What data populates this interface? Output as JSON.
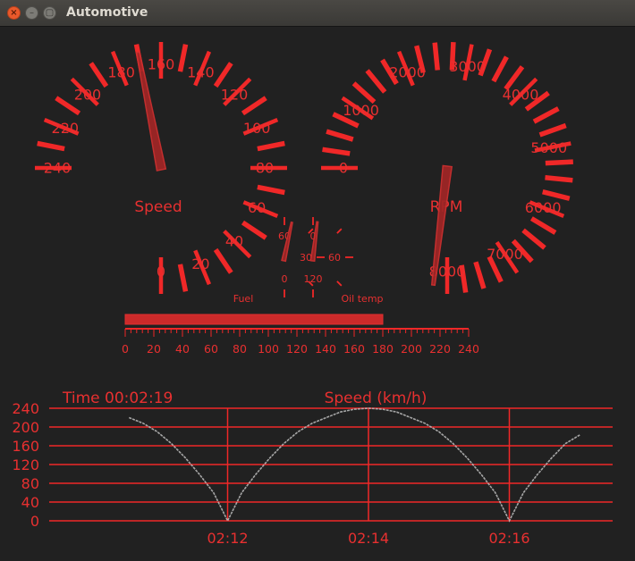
{
  "window": {
    "title": "Automotive",
    "buttons": {
      "close": "×",
      "minimize": "–",
      "maximize": "▢"
    }
  },
  "colors": {
    "accent": "#f02828",
    "background": "#212121",
    "plot_line": "#bdbdbd"
  },
  "speedometer": {
    "label": "Speed",
    "ticks": [
      "0",
      "20",
      "40",
      "60",
      "80",
      "100",
      "120",
      "140",
      "160",
      "180",
      "200",
      "220",
      "240"
    ],
    "value": 170
  },
  "tachometer": {
    "label": "RPM",
    "ticks": [
      "0",
      "1000",
      "2000",
      "3000",
      "4000",
      "5000",
      "6000",
      "7000",
      "8000"
    ],
    "value": 8200
  },
  "fuel_gauge": {
    "label": "Fuel",
    "ticks": [
      "0",
      "30",
      "60"
    ]
  },
  "oil_temp_gauge": {
    "label": "Oil temp",
    "ticks": [
      "0",
      "60",
      "120"
    ]
  },
  "speed_bar": {
    "value": 180,
    "max": 240,
    "ticks": [
      "0",
      "20",
      "40",
      "60",
      "80",
      "100",
      "120",
      "140",
      "160",
      "180",
      "200",
      "220",
      "240"
    ]
  },
  "chart_data": {
    "type": "line",
    "title": "Speed (km/h)",
    "time_label": "Time 00:02:19",
    "yticks": [
      "0",
      "40",
      "80",
      "120",
      "160",
      "200",
      "240"
    ],
    "ylim": [
      0,
      240
    ],
    "xlim": [
      -3.8,
      8.2
    ],
    "xticks": [
      {
        "value": 0,
        "label": "02:12"
      },
      {
        "value": 3,
        "label": "02:14"
      },
      {
        "value": 6,
        "label": "02:16"
      }
    ],
    "grid": true,
    "series": [
      {
        "x": [
          -2.1,
          -1.8,
          -1.5,
          -1.2,
          -0.9,
          -0.6,
          -0.3,
          0,
          0.3,
          0.6,
          0.9,
          1.2,
          1.5,
          1.8,
          2.1,
          2.4,
          2.7,
          3,
          3.3,
          3.6,
          3.9,
          4.2,
          4.5,
          4.8,
          5.1,
          5.4,
          5.7,
          6,
          6.3,
          6.6,
          6.9,
          7.2,
          7.5
        ],
        "y": [
          220,
          208,
          190,
          165,
          134,
          99,
          60,
          0,
          60,
          99,
          134,
          165,
          190,
          208,
          220,
          232,
          238,
          240,
          238,
          232,
          220,
          208,
          190,
          165,
          134,
          99,
          60,
          0,
          60,
          99,
          134,
          165,
          183
        ]
      }
    ]
  }
}
